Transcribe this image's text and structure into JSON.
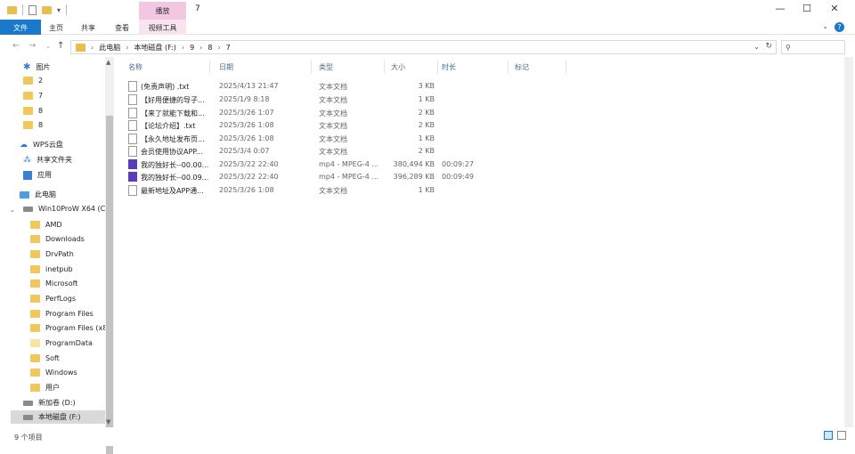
{
  "window": {
    "context_tab": "播放",
    "title": "7"
  },
  "ribbon": {
    "tabs": [
      "文件",
      "主页",
      "共享",
      "查看",
      "视频工具"
    ]
  },
  "address": {
    "crumbs": [
      "此电脑",
      "本地磁盘 (F:)",
      "9",
      "8",
      "7"
    ]
  },
  "sidebar": {
    "quick_access": "图片",
    "folders": [
      "2",
      "7",
      "8",
      "8"
    ],
    "wps": "WPS云盘",
    "shared": "共享文件夹",
    "apps": "应用",
    "this_pc": "此电脑",
    "drive_c": "Win10ProW X64 (C:)",
    "c_folders": [
      "AMD",
      "Downloads",
      "DrvPath",
      "inetpub",
      "Microsoft",
      "PerfLogs",
      "Program Files",
      "Program Files (x86)",
      "ProgramData",
      "Soft",
      "Windows",
      "用户"
    ],
    "drive_d": "新加卷 (D:)",
    "drive_f": "本地磁盘 (F:)"
  },
  "columns": [
    "名称",
    "日期",
    "类型",
    "大小",
    "时长",
    "标记"
  ],
  "files": [
    {
      "name": "(免责声明) .txt",
      "date": "2025/4/13 21:47",
      "type": "文本文档",
      "size": "3 KB",
      "duration": "",
      "kind": "txt"
    },
    {
      "name": "【好用便捷的导子...",
      "date": "2025/1/9 8:18",
      "type": "文本文档",
      "size": "1 KB",
      "duration": "",
      "kind": "txt"
    },
    {
      "name": "【来了就能下载和...",
      "date": "2025/3/26 1:07",
      "type": "文本文档",
      "size": "2 KB",
      "duration": "",
      "kind": "txt"
    },
    {
      "name": "【论坛介绍】.txt",
      "date": "2025/3/26 1:08",
      "type": "文本文档",
      "size": "2 KB",
      "duration": "",
      "kind": "txt"
    },
    {
      "name": "【永久地址发布页...",
      "date": "2025/3/26 1:08",
      "type": "文本文档",
      "size": "1 KB",
      "duration": "",
      "kind": "txt"
    },
    {
      "name": "会员使用协议APP...",
      "date": "2025/3/4 0:07",
      "type": "文本文档",
      "size": "2 KB",
      "duration": "",
      "kind": "txt"
    },
    {
      "name": "我的独好长--00.00...",
      "date": "2025/3/22 22:40",
      "type": "mp4 - MPEG-4 ...",
      "size": "380,494 KB",
      "duration": "00:09:27",
      "kind": "mp4"
    },
    {
      "name": "我的独好长--00.09...",
      "date": "2025/3/22 22:40",
      "type": "mp4 - MPEG-4 ...",
      "size": "396,289 KB",
      "duration": "00:09:49",
      "kind": "mp4"
    },
    {
      "name": "最新地址及APP通...",
      "date": "2025/3/26 1:08",
      "type": "文本文档",
      "size": "1 KB",
      "duration": "",
      "kind": "txt"
    }
  ],
  "status": {
    "count": "9 个项目"
  },
  "colors": {
    "accent": "#1979ca",
    "context_tab": "#f3c7e2",
    "folder": "#f0c75a",
    "video_icon": "#5a3fb4"
  }
}
